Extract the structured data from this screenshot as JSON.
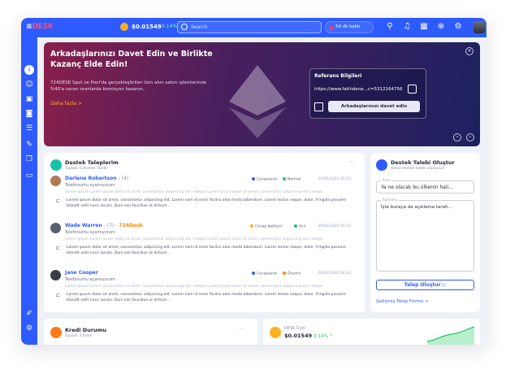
{
  "topbar": {
    "logo": "DESK",
    "price": "$0.01549",
    "change": "0.14% ^",
    "search_placeholder": "Search",
    "timer": "54 dk kaldı"
  },
  "hero": {
    "title": "Arkadaşlarınızı Davet Edin ve Birlikte Kazanç Elde Edin!",
    "description": "724DESK Spot ve Pool'da gerçekleştirilen tüm alım satım işlemlerinde %40'a varan oranlarda komisyon kazanın.",
    "more": "Daha fazla  >",
    "referral_title": "Referans Bilgileri",
    "referral_url": "https://www.fatihdene...c=5312164756",
    "invite_button": "Arkadaşlarınızı davet edin"
  },
  "tickets": {
    "title": "Destek Taleplerim",
    "subtitle": "Toplam 4 Destek Talebi",
    "more": "...",
    "items": [
      {
        "name": "Darlene Robertson",
        "count": "- (4)",
        "company": "",
        "topic": "Telefonumu açamıyorum",
        "status": "Cevaplandı",
        "status_color": "#2e5bff",
        "priority": "Normal",
        "priority_color": "#22c55e",
        "date": "20/02/2022 16:12",
        "preview": "Lorem ipsum Lorem ipsum dolor sit amet, consectetur adipiscing elit. Integer Lorem ipsum dolor sit amet, consectetur adipiscing elit. Intege...",
        "reply": "Lorem ipsum dolor sit amet, consectetur adipiscing elit. Lorem nam id enim facilisi odio morbi bibendum. Lorem lectus neque, dolor, fringilla posuere blandit velit nunc iaculis. Duis non faucibus ut dictum..."
      },
      {
        "name": "Wade Warren",
        "count": "- (7) -",
        "company": "724Desk",
        "topic": "Telefonumu açamıyorum",
        "status": "Cevap bekliyor",
        "status_color": "#ffb020",
        "priority": "Acil",
        "priority_color": "#22c55e",
        "date": "20/02/2022 16:12",
        "preview": "Lorem ipsum Lorem ipsum dolor sit amet, consectetur adipiscing elit. Integer Lorem ipsum dolor sit amet, consectetur adipiscing elit. Intege...",
        "reply": "Lorem ipsum dolor sit amet, consectetur adipiscing elit. Lorem nam id enim facilisi odio morbi bibendum. Lorem lectus neque, dolor, fringilla posuere blandit velit nunc iaculis. Duis non faucibus ut dictum..."
      },
      {
        "name": "Jane Cooper",
        "count": "",
        "company": "",
        "topic": "Telefonumu açamıyorum",
        "status": "Cevaplandı",
        "status_color": "#2e5bff",
        "priority": "Önemli",
        "priority_color": "#ff8a00",
        "date": "20/02/2022 16:12",
        "preview": "Lorem ipsum Lorem ipsum dolor sit amet, consectetur adipiscing elit. Integer Lorem ipsum dolor sit amet, consectetur adipiscing elit. Intege...",
        "reply": "Lorem ipsum dolor sit amet, consectetur adipiscing elit. Lorem nam id enim facilisi odio morbi bibendum. Lorem lectus neque, dolor, fringilla posuere blandit velit nunc iaculis. Duis non faucibus ut dictum..."
      }
    ]
  },
  "create": {
    "title": "Destek Talebi Oluştur",
    "subtitle": "Yalnız destek talebi oluşturun",
    "subject_label": "Konu",
    "subject_value": "Ya ne olacak bu ülkenin hali...",
    "desc_label": "Açıklama",
    "desc_value": "İşte buraya da açıklama tarafı...",
    "button": "Talep Oluştur",
    "advanced_link": "Gelişmiş Talep Formu  >"
  },
  "credit": {
    "title": "Kredi Durumu",
    "subtitle": "Toplam 4 Kredi",
    "more": "..."
  },
  "coin": {
    "name": "DESK Coin",
    "price": "$0.01549",
    "change": "0.14% ^"
  }
}
